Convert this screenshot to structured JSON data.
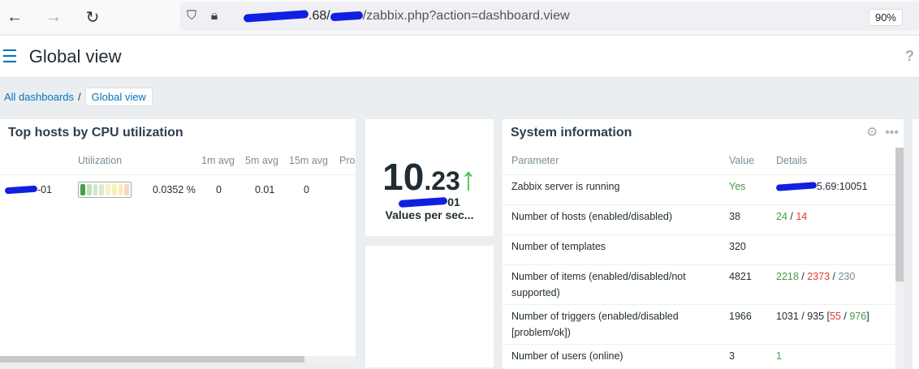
{
  "browser": {
    "url_part1": ".68/",
    "url_part2": "/zabbix.php?action=dashboard.view",
    "zoom": "90%"
  },
  "header": {
    "title": "Global view",
    "help": "?"
  },
  "breadcrumb": {
    "all": "All dashboards",
    "sep": "/",
    "current": "Global view"
  },
  "cpu_widget": {
    "title": "Top hosts by CPU utilization",
    "columns": [
      "",
      "Utilization",
      "",
      "1m avg",
      "5m avg",
      "15m avg",
      "Pro"
    ],
    "rows": [
      {
        "host_suffix": "-01",
        "utilization": "0.0352 %",
        "avg1": "0",
        "avg5": "0.01",
        "avg15": "0"
      }
    ]
  },
  "item_widget": {
    "value_int": "10",
    "value_dec": ".23",
    "host_suffix": "01",
    "label": "Values per sec..."
  },
  "sysinfo": {
    "title": "System information",
    "columns": [
      "Parameter",
      "Value",
      "Details"
    ],
    "rows": [
      {
        "param": "Zabbix server is running",
        "value": "Yes",
        "details": "5.69:10051"
      },
      {
        "param": "Number of hosts (enabled/disabled)",
        "value": "38",
        "d1": "24",
        "d2": "14"
      },
      {
        "param": "Number of templates",
        "value": "320"
      },
      {
        "param": "Number of items (enabled/disabled/not supported)",
        "value": "4821",
        "d1": "2218",
        "d2": "2373",
        "d3": "230"
      },
      {
        "param": "Number of triggers (enabled/disabled [problem/ok])",
        "value": "1966",
        "d1": "1031 / 935 [",
        "d2": "55",
        "d3": "976",
        "d4": "]"
      },
      {
        "param": "Number of users (online)",
        "value": "3",
        "d1": "1"
      }
    ]
  }
}
